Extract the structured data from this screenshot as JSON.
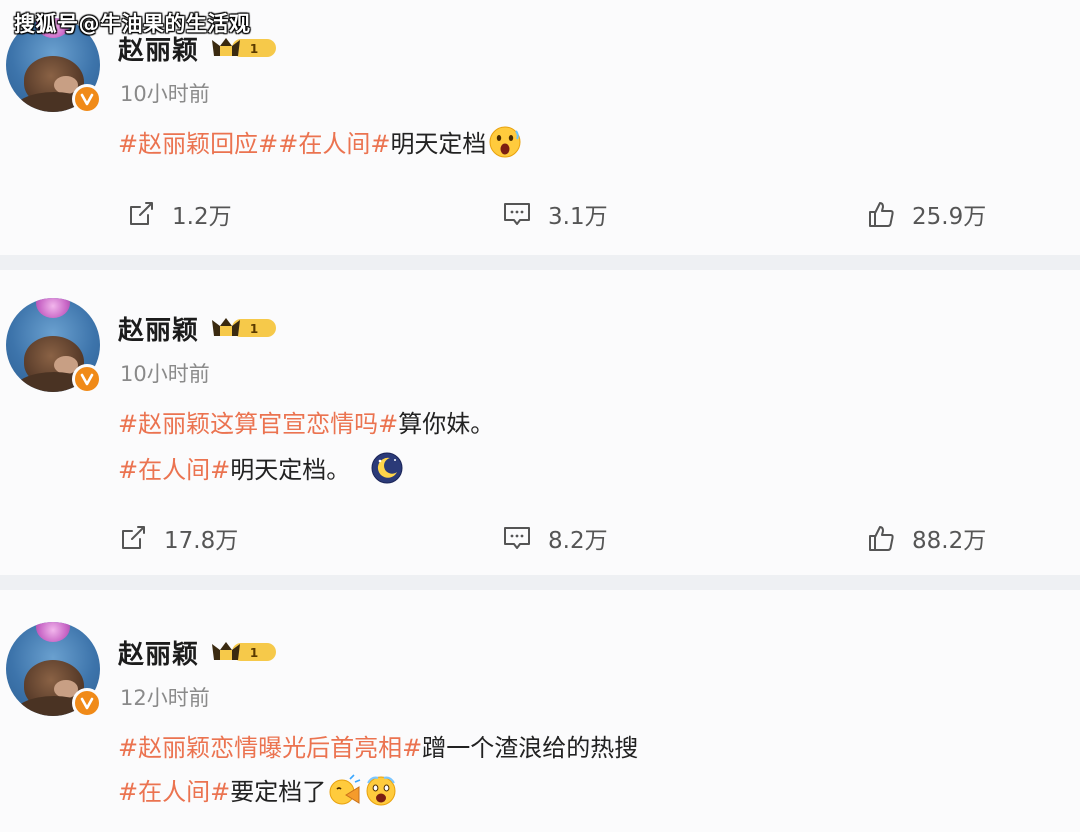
{
  "watermark": "搜狐号@牛油果的生活观",
  "posts": [
    {
      "username": "赵丽颖",
      "vip_level": "1",
      "time": "10小时前",
      "lines": [
        [
          {
            "type": "hashtag",
            "text": "#赵丽颖回应#"
          },
          {
            "type": "hashtag",
            "text": "#在人间#"
          },
          {
            "type": "plain",
            "text": " 明天定档"
          },
          {
            "type": "emoji",
            "name": "shocked-emoji"
          }
        ]
      ],
      "shares": "1.2万",
      "comments": "3.1万",
      "likes": "25.9万"
    },
    {
      "username": "赵丽颖",
      "vip_level": "1",
      "time": "10小时前",
      "lines": [
        [
          {
            "type": "hashtag",
            "text": "#赵丽颖这算官宣恋情吗#"
          },
          {
            "type": "plain",
            "text": " 算你妹。"
          }
        ],
        [
          {
            "type": "hashtag",
            "text": "#在人间#"
          },
          {
            "type": "plain",
            "text": "明天定档。"
          },
          {
            "type": "emoji",
            "name": "moon-emoji"
          }
        ]
      ],
      "shares": "17.8万",
      "comments": "8.2万",
      "likes": "88.2万"
    },
    {
      "username": "赵丽颖",
      "vip_level": "1",
      "time": "12小时前",
      "lines": [
        [
          {
            "type": "hashtag",
            "text": "#赵丽颖恋情曝光后首亮相#"
          },
          {
            "type": "plain",
            "text": "蹭一个渣浪给的热搜"
          }
        ],
        [
          {
            "type": "hashtag",
            "text": "#在人间#"
          },
          {
            "type": "plain",
            "text": "要定档了"
          },
          {
            "type": "emoji",
            "name": "horn-emoji"
          },
          {
            "type": "emoji",
            "name": "screaming-emoji"
          }
        ]
      ],
      "shares": "",
      "comments": "",
      "likes": ""
    }
  ]
}
